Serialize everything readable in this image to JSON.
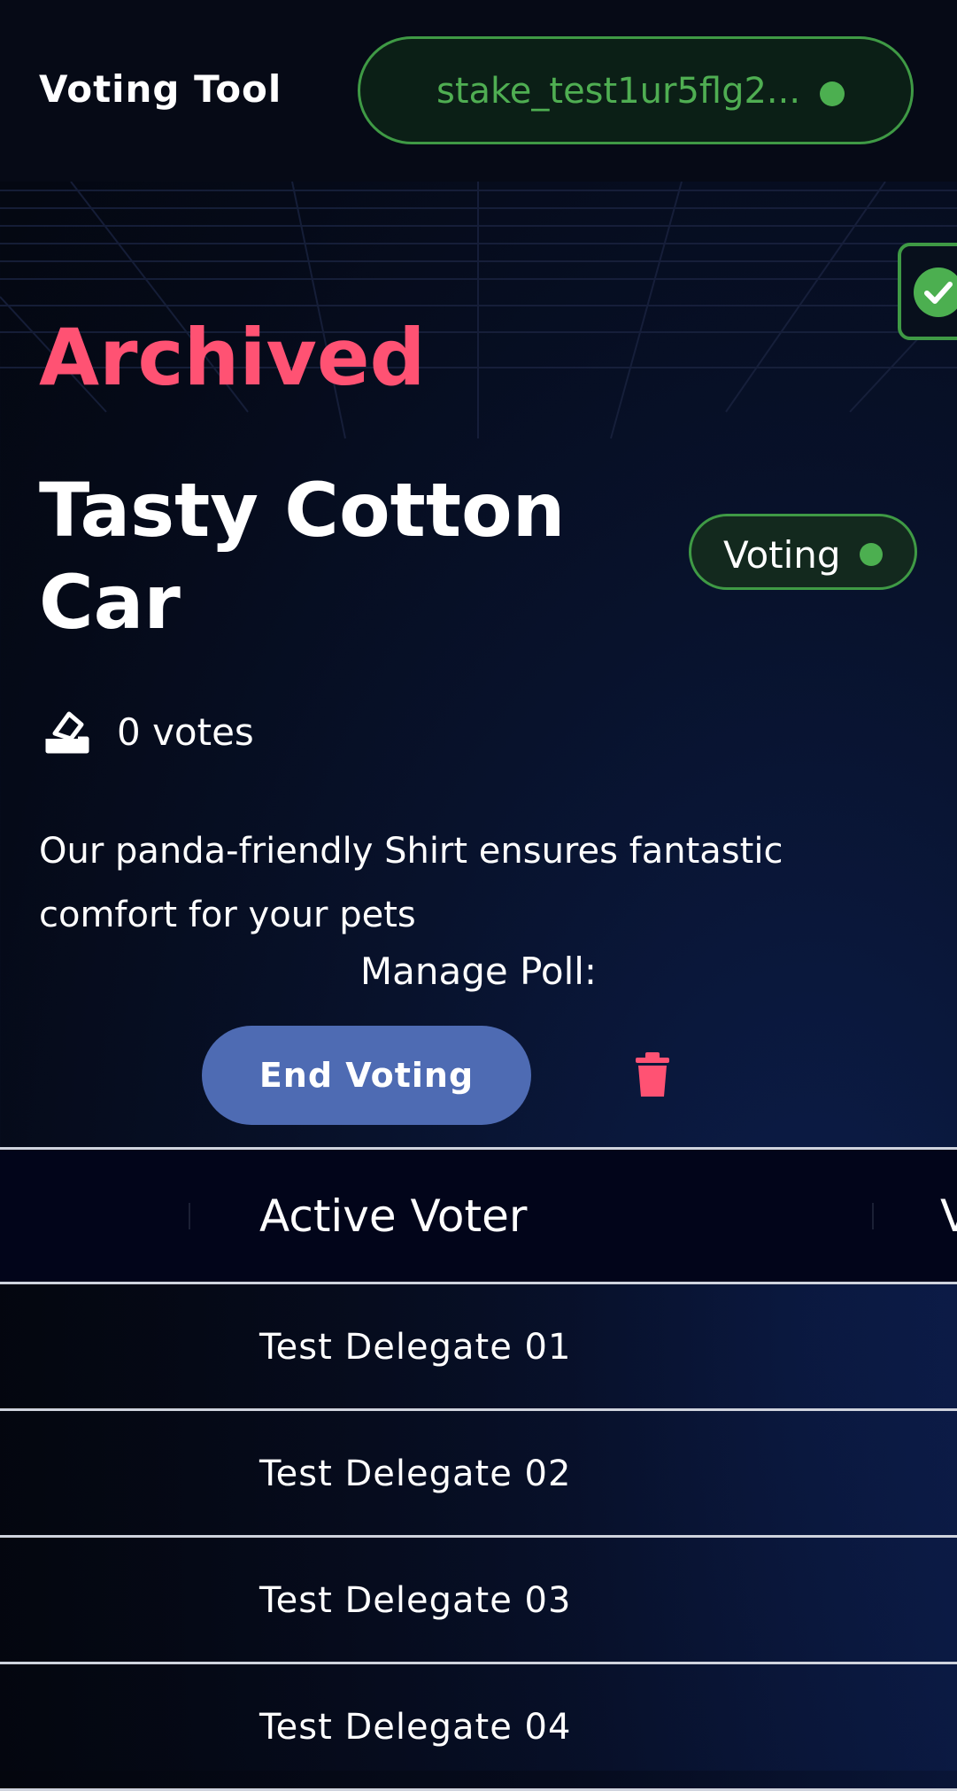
{
  "header": {
    "app_title": "Voting Tool",
    "wallet_address": "stake_test1ur5flg2...",
    "wallet_status_color": "#4caf50"
  },
  "toast": {
    "icon": "check-circle-icon",
    "color": "#4caf50"
  },
  "poll": {
    "status_heading": "Archived",
    "title": "Tasty Cotton Car",
    "badge_label": "Voting",
    "votes_text": "0 votes",
    "votes_icon": "ballot-box-icon",
    "description": "Our panda-friendly Shirt ensures fantastic comfort for your pets"
  },
  "manage": {
    "label": "Manage Poll:",
    "end_voting_label": "End Voting",
    "delete_icon": "trash-icon"
  },
  "table": {
    "headers": [
      "Active Voter",
      "V"
    ],
    "rows": [
      {
        "voter": "Test Delegate 01"
      },
      {
        "voter": "Test Delegate 02"
      },
      {
        "voter": "Test Delegate 03"
      },
      {
        "voter": "Test Delegate 04"
      }
    ]
  },
  "colors": {
    "accent_red": "#ff5273",
    "accent_green": "#4caf50",
    "button_blue": "#4e6bb3"
  }
}
